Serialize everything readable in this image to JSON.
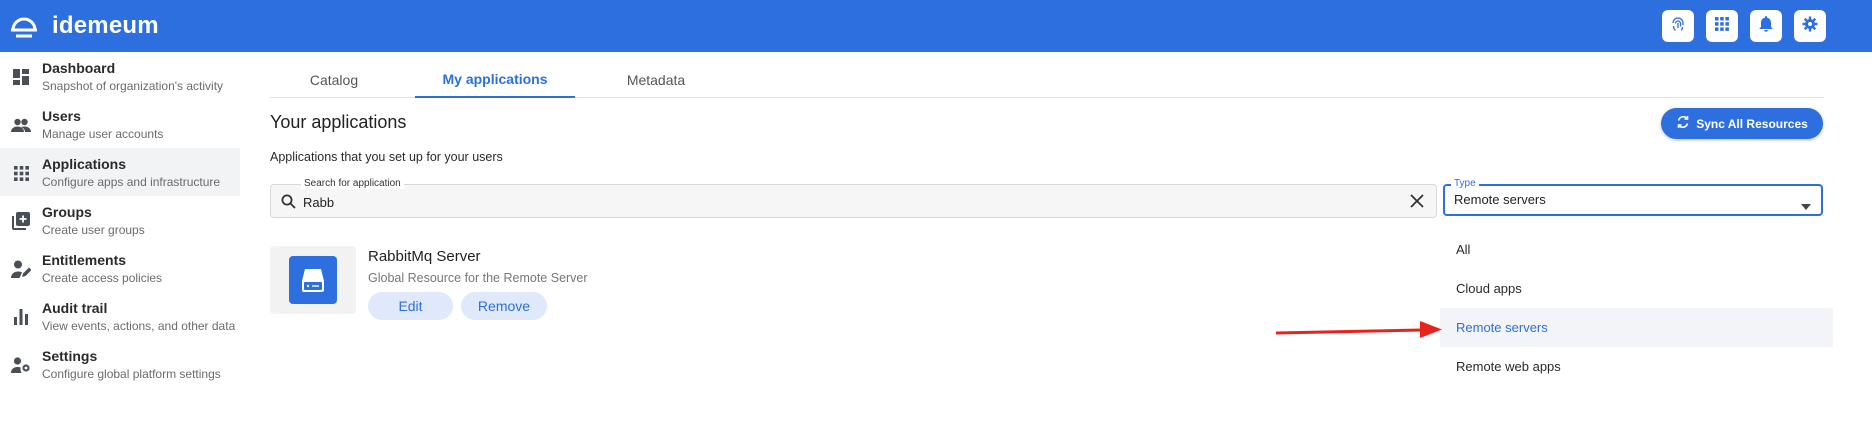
{
  "brand": {
    "name": "idemeum"
  },
  "colors": {
    "primary": "#2d6fdf",
    "arrow": "#e8231b"
  },
  "topbar": {
    "actions": [
      {
        "icon": "fingerprint-icon"
      },
      {
        "icon": "apps-grid-icon"
      },
      {
        "icon": "bell-icon"
      },
      {
        "icon": "gear-icon"
      }
    ]
  },
  "sidebar": {
    "items": [
      {
        "title": "Dashboard",
        "subtitle": "Snapshot of organization's activity",
        "icon": "dashboard-icon"
      },
      {
        "title": "Users",
        "subtitle": "Manage user accounts",
        "icon": "users-icon"
      },
      {
        "title": "Applications",
        "subtitle": "Configure apps and infrastructure",
        "icon": "apps-grid-icon"
      },
      {
        "title": "Groups",
        "subtitle": "Create user groups",
        "icon": "groups-icon"
      },
      {
        "title": "Entitlements",
        "subtitle": "Create access policies",
        "icon": "entitlements-icon"
      },
      {
        "title": "Audit trail",
        "subtitle": "View events, actions, and other data",
        "icon": "bar-chart-icon"
      },
      {
        "title": "Settings",
        "subtitle": "Configure global platform settings",
        "icon": "settings-user-icon"
      }
    ],
    "active_index": 2
  },
  "tabs": [
    {
      "label": "Catalog"
    },
    {
      "label": "My applications"
    },
    {
      "label": "Metadata"
    }
  ],
  "active_tab": 1,
  "main": {
    "title": "Your applications",
    "subtitle": "Applications that you set up for your users",
    "sync_label": "Sync All Resources"
  },
  "search": {
    "label": "Search for application",
    "value": "Rabb"
  },
  "type_filter": {
    "label": "Type",
    "value": "Remote servers",
    "options": [
      "All",
      "Cloud apps",
      "Remote servers",
      "Remote web apps"
    ],
    "selected_index": 2
  },
  "application": {
    "name": "RabbitMq Server",
    "description": "Global Resource for the Remote Server",
    "edit_label": "Edit",
    "remove_label": "Remove",
    "icon": "server-drive-icon"
  }
}
